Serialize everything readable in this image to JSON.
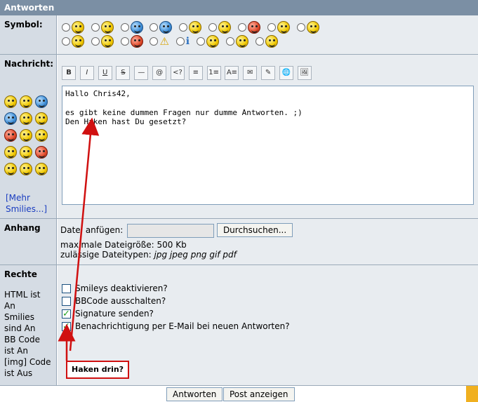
{
  "title": "Antworten",
  "symbol": {
    "label": "Symbol:"
  },
  "nachricht": {
    "label": "Nachricht:",
    "more_smilies": "[Mehr Smilies...]",
    "text_lines": [
      "Hallo Chris42,",
      "",
      "es gibt keine dummen Fragen nur dumme Antworten. ;)",
      "Den Haken hast Du gesetzt?"
    ],
    "toolbar": [
      "B",
      "I",
      "U",
      "S",
      "—",
      "@",
      "<?",
      "≡",
      "1≡",
      "A≡",
      "✉",
      "✎",
      "🌐",
      "🖼"
    ]
  },
  "anhang": {
    "label": "Anhang",
    "file_label": "Datei anfügen:",
    "browse": "Durchsuchen...",
    "max_size": "maximale Dateigröße: 500 Kb",
    "types_label": "zulässige Dateitypen:",
    "types": "jpg jpeg png gif pdf"
  },
  "rechte": {
    "label": "Rechte",
    "lines": [
      "HTML ist",
      "An",
      "Smilies",
      "sind An",
      "BB Code",
      "ist An",
      "[img] Code",
      "ist Aus"
    ],
    "options": [
      {
        "label": "Smileys deaktivieren?",
        "checked": false
      },
      {
        "label": "BBCode ausschalten?",
        "checked": false
      },
      {
        "label": "Signature senden?",
        "checked": true
      },
      {
        "label": "Benachrichtigung per E-Mail bei neuen Antworten?",
        "checked": true
      }
    ],
    "annotation": "Haken drin?"
  },
  "buttons": {
    "submit": "Antworten",
    "preview": "Post anzeigen"
  },
  "colors": {
    "annotation": "#d01010"
  }
}
